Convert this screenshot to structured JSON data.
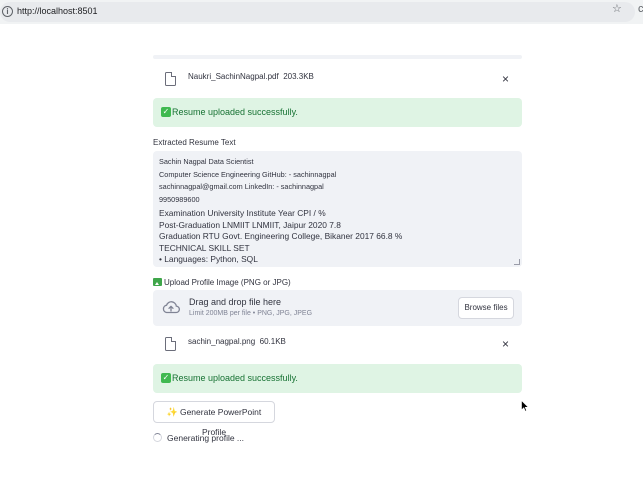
{
  "browser": {
    "url": "http://localhost:8501",
    "info_icon": "i",
    "star_icon": "☆",
    "extension_icon": "c"
  },
  "resume_file": {
    "name": "Naukri_SachinNagpal.pdf",
    "size": "203.3KB",
    "close_icon": "×"
  },
  "resume_success": {
    "check": "✓",
    "text": "Resume uploaded successfully."
  },
  "extracted": {
    "label": "Extracted Resume Text",
    "lines_small": [
      "Sachin Nagpal Data Scientist",
      "Computer Science Engineering GitHub: - sachinnagpal",
      "sachinnagpal@gmail.com LinkedIn: - sachinnagpal",
      "9950989600"
    ],
    "lines_big": [
      "Examination University Institute Year CPI / %",
      "Post-Graduation LNMIIT LNMIIT, Jaipur 2020 7.8",
      "Graduation RTU Govt. Engineering College, Bikaner 2017 66.8 %",
      "TECHNICAL SKILL SET",
      "• Languages: Python, SQL"
    ]
  },
  "profile_image": {
    "label": "Upload Profile Image (PNG or JPG)",
    "dropzone_title": "Drag and drop file here",
    "dropzone_sub": "Limit 200MB per file • PNG, JPG, JPEG",
    "browse_label": "Browse files"
  },
  "image_file": {
    "name": "sachin_nagpal.png",
    "size": "60.1KB",
    "close_icon": "×"
  },
  "image_success": {
    "check": "✓",
    "text": "Resume uploaded successfully."
  },
  "generate": {
    "icon": "✨",
    "label": "Generate PowerPoint Profile",
    "status": "Generating profile ..."
  },
  "colors": {
    "success_bg": "#dff4e4",
    "success_text": "#177233",
    "panel_bg": "#f0f2f6"
  }
}
